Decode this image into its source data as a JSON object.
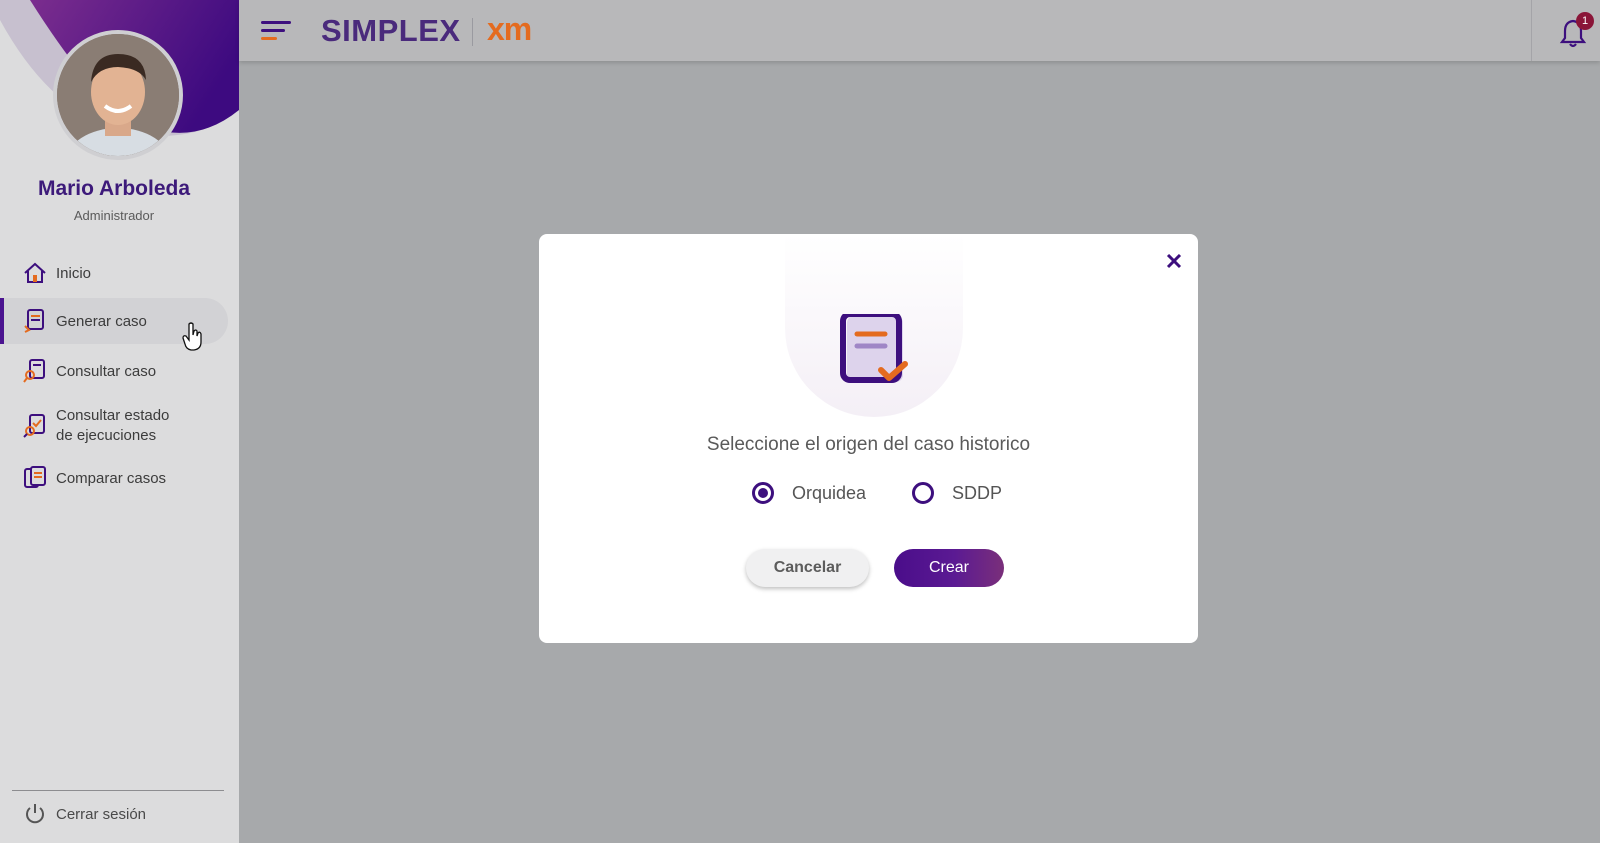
{
  "user": {
    "name": "Mario Arboleda",
    "role": "Administrador"
  },
  "sidebar": {
    "items": [
      {
        "label": "Inicio",
        "icon": "home-icon"
      },
      {
        "label": "Generar caso",
        "icon": "generate-case-icon",
        "active": true
      },
      {
        "label": "Consultar caso",
        "icon": "search-case-icon"
      },
      {
        "label_line1": "Consultar estado",
        "label_line2": "de ejecuciones",
        "icon": "execution-status-icon"
      },
      {
        "label": "Comparar casos",
        "icon": "compare-cases-icon"
      }
    ],
    "logout_label": "Cerrar sesión"
  },
  "header": {
    "brand": "SIMPLEX",
    "brand_secondary": "xm",
    "notification_count": "1"
  },
  "dialog": {
    "title": "Seleccione el origen del caso historico",
    "options": [
      {
        "label": "Orquidea",
        "selected": true
      },
      {
        "label": "SDDP",
        "selected": false
      }
    ],
    "cancel_label": "Cancelar",
    "create_label": "Crear"
  },
  "colors": {
    "primary": "#3d0f7e",
    "accent": "#e46b1f",
    "badge": "#8a1538",
    "overlay": "#a7a9ab"
  }
}
